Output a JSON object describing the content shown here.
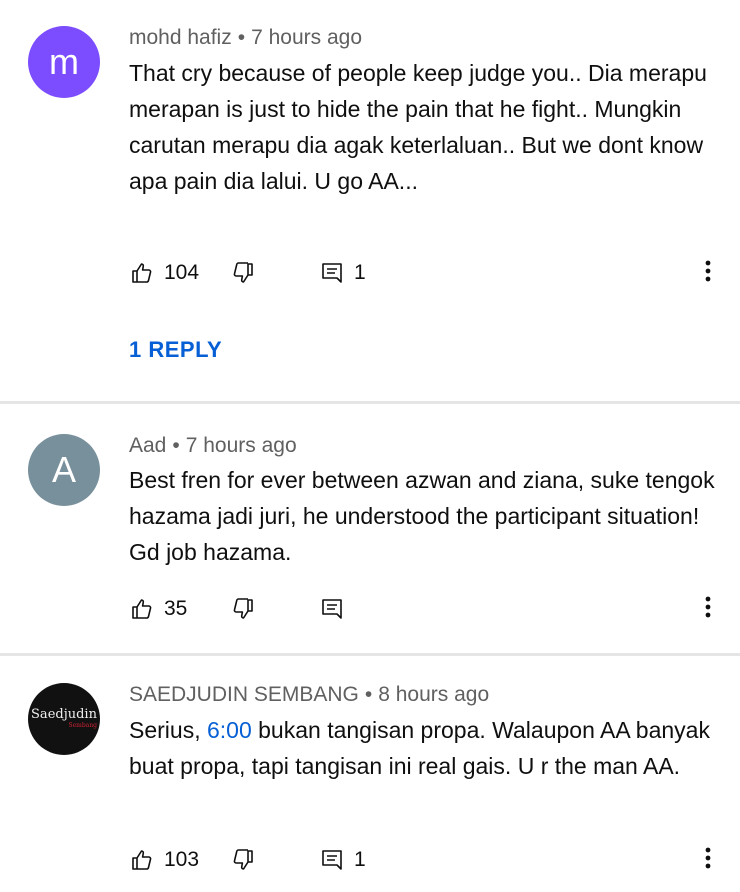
{
  "comments": [
    {
      "author": "mohd hafiz",
      "time": "7 hours ago",
      "avatar_letter": "m",
      "avatar_color": "#7c4dff",
      "text": "That cry because of  people keep judge you..  Dia merapu merapan is just to hide the pain that he fight.. Mungkin carutan merapu dia agak keterlaluan.. But we dont know apa pain dia lalui.   U go AA...",
      "likes": "104",
      "replies_count": "1",
      "reply_link": "1 REPLY"
    },
    {
      "author": "Aad",
      "time": "7 hours ago",
      "avatar_letter": "A",
      "avatar_color": "#78909c",
      "text": "Best fren for ever between azwan and ziana, suke tengok hazama jadi juri, he understood the participant situation! Gd job hazama.",
      "likes": "35"
    },
    {
      "author": "SAEDJUDIN SEMBANG",
      "time": "8 hours ago",
      "avatar_text": "Saedjudin",
      "avatar_subtext": "Sembang",
      "avatar_color": "#111111",
      "text_before": "Serius, ",
      "timestamp_link": "6:00",
      "text_after": " bukan tangisan propa. Walaupon AA banyak buat propa, tapi tangisan ini real gais. U r the man AA.",
      "likes": "103",
      "replies_count": "1"
    }
  ],
  "separator": "•",
  "icons": {
    "like": "thumbs-up-icon",
    "dislike": "thumbs-down-icon",
    "reply": "comment-icon",
    "more": "more-vert-icon"
  },
  "colors": {
    "link": "#065fd4",
    "meta": "#606060",
    "divider": "#e5e5e5"
  }
}
